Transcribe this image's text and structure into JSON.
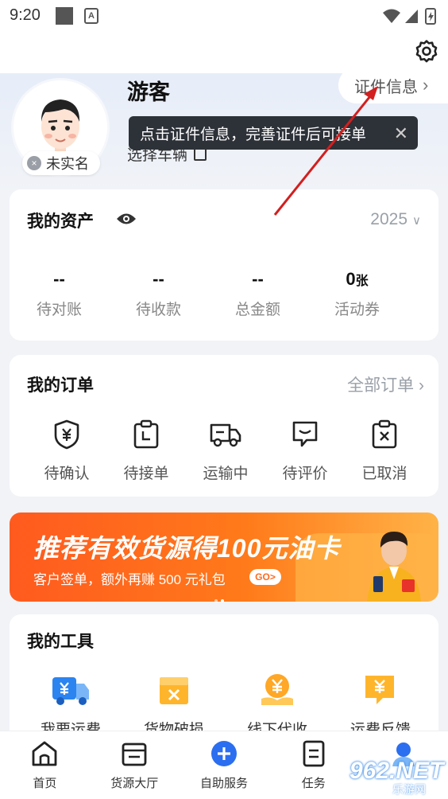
{
  "status_bar": {
    "time": "9:20"
  },
  "profile": {
    "username": "游客",
    "realname_status": "未实名",
    "vehicle_link": "选择车辆",
    "cert_button": "证件信息"
  },
  "tooltip": {
    "text": "点击证件信息，完善证件后可接单"
  },
  "assets": {
    "title": "我的资产",
    "year": "2025",
    "stats": [
      {
        "value": "--",
        "label": "待对账"
      },
      {
        "value": "--",
        "label": "待收款"
      },
      {
        "value": "--",
        "label": "总金额"
      },
      {
        "value": "0",
        "unit": "张",
        "label": "活动券"
      }
    ]
  },
  "orders": {
    "title": "我的订单",
    "all_link": "全部订单",
    "items": [
      {
        "label": "待确认",
        "icon": "yen-shield-icon"
      },
      {
        "label": "待接单",
        "icon": "clipboard-clock-icon"
      },
      {
        "label": "运输中",
        "icon": "truck-icon"
      },
      {
        "label": "待评价",
        "icon": "chat-smile-icon"
      },
      {
        "label": "已取消",
        "icon": "clipboard-x-icon"
      }
    ]
  },
  "banner": {
    "headline": "推荐有效货源得100元油卡",
    "subline": "客户签单，额外再赚 500 元礼包",
    "go": "GO>"
  },
  "tools": {
    "title": "我的工具",
    "items": [
      {
        "label": "我要运费",
        "icon": "yen-truck-icon"
      },
      {
        "label": "货物破损",
        "icon": "damaged-box-icon"
      },
      {
        "label": "线下代收",
        "icon": "yen-hand-icon"
      },
      {
        "label": "运费反馈",
        "icon": "yen-chat-icon"
      }
    ]
  },
  "nav": {
    "items": [
      {
        "label": "首页",
        "icon": "home-icon"
      },
      {
        "label": "货源大厅",
        "icon": "cargo-hall-icon"
      },
      {
        "label": "自助服务",
        "icon": "plus-circle-icon"
      },
      {
        "label": "任务",
        "icon": "task-list-icon"
      },
      {
        "label": "",
        "icon": "profile-icon"
      }
    ]
  },
  "watermark": {
    "big": "962.NET",
    "small": "乐游网"
  },
  "colors": {
    "accent": "#2b6ef0",
    "banner": "#ff6a1f",
    "tooltip": "#2d3138",
    "icon_orange": "#ffae1a"
  }
}
